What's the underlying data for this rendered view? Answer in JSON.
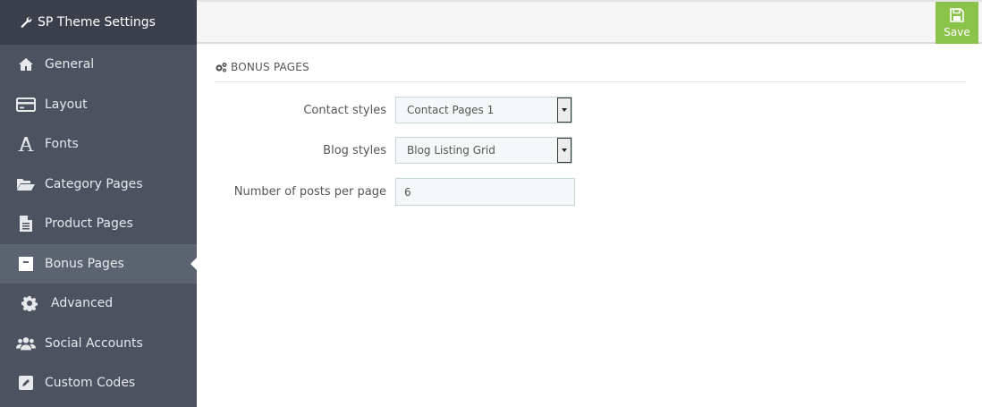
{
  "sidebar": {
    "title": "SP Theme Settings",
    "items": [
      {
        "label": "General",
        "icon": "home-icon"
      },
      {
        "label": "Layout",
        "icon": "card-icon"
      },
      {
        "label": "Fonts",
        "icon": "font-icon"
      },
      {
        "label": "Category Pages",
        "icon": "folder-open-icon"
      },
      {
        "label": "Product Pages",
        "icon": "file-icon"
      },
      {
        "label": "Bonus Pages",
        "icon": "archive-icon"
      },
      {
        "label": "Advanced",
        "icon": "gear-icon"
      },
      {
        "label": "Social Accounts",
        "icon": "users-icon"
      },
      {
        "label": "Custom Codes",
        "icon": "edit-icon"
      }
    ],
    "active_index": 5
  },
  "toolbar": {
    "save_label": "Save"
  },
  "section": {
    "title": "BONUS PAGES"
  },
  "form": {
    "contact_label": "Contact styles",
    "contact_value": "Contact Pages 1",
    "blog_label": "Blog styles",
    "blog_value": "Blog Listing Grid",
    "posts_label": "Number of posts per page",
    "posts_value": "6"
  },
  "colors": {
    "sidebar_bg": "#4c5260",
    "sidebar_header_bg": "#3a3f4b",
    "active_bg": "#5c6370",
    "save_green": "#8bc34a"
  }
}
